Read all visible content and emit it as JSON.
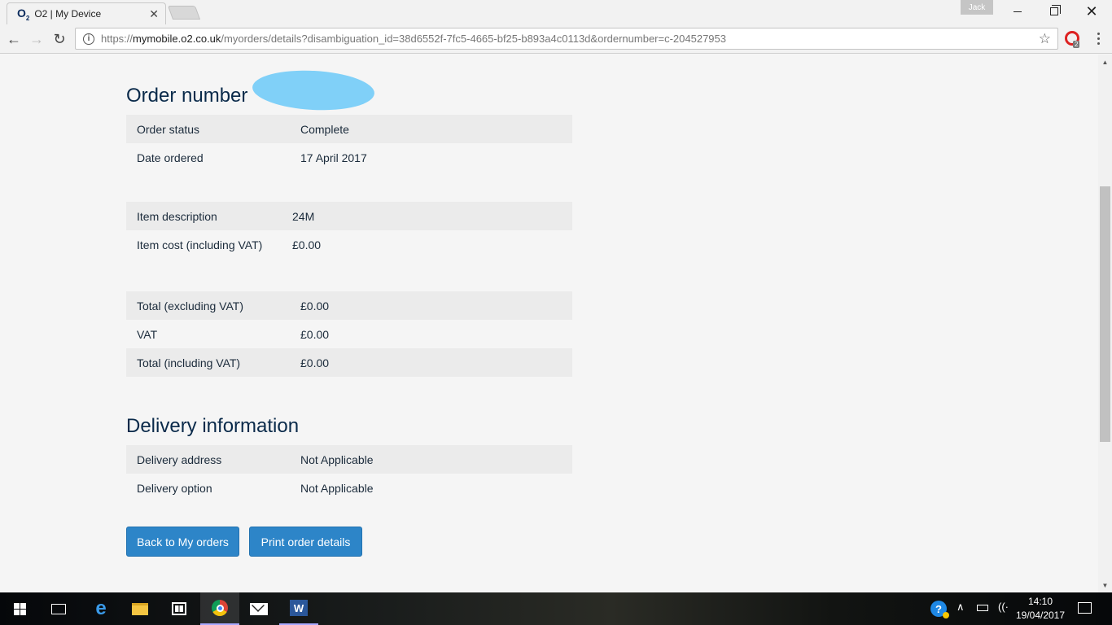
{
  "browser": {
    "tab_title": "O2 | My Device",
    "tab_favicon": "O",
    "tab_favicon_sub": "2",
    "profile_name": "Jack",
    "url_host": "mymobile.o2.co.uk",
    "url_path": "/myorders/details?disambiguation_id=38d6552f-7fc5-4665-bf25-b893a4c0113d&ordernumber=c-204527953",
    "url_scheme": "https://",
    "extension_badge": "2"
  },
  "order": {
    "title": "Order number",
    "status_rows": [
      {
        "label": "Order status",
        "value": "Complete"
      },
      {
        "label": "Date ordered",
        "value": "17 April 2017"
      }
    ],
    "item_rows": [
      {
        "label": "Item description",
        "value": "24M"
      },
      {
        "label": "Item cost (including VAT)",
        "value": "£0.00"
      }
    ],
    "total_rows": [
      {
        "label": "Total (excluding VAT)",
        "value": "£0.00"
      },
      {
        "label": "VAT",
        "value": "£0.00"
      },
      {
        "label": "Total (including VAT)",
        "value": "£0.00"
      }
    ]
  },
  "delivery": {
    "title": "Delivery information",
    "rows": [
      {
        "label": "Delivery address",
        "value": "Not Applicable"
      },
      {
        "label": "Delivery option",
        "value": "Not Applicable"
      }
    ]
  },
  "actions": {
    "back_label": "Back to My orders",
    "print_label": "Print order details"
  },
  "taskbar": {
    "time": "14:10",
    "date": "19/04/2017",
    "word_letter": "W",
    "edge_letter": "e"
  },
  "colors": {
    "accent_button": "#2d85c8",
    "heading": "#0a2a4a",
    "redaction": "#80d0f8"
  }
}
